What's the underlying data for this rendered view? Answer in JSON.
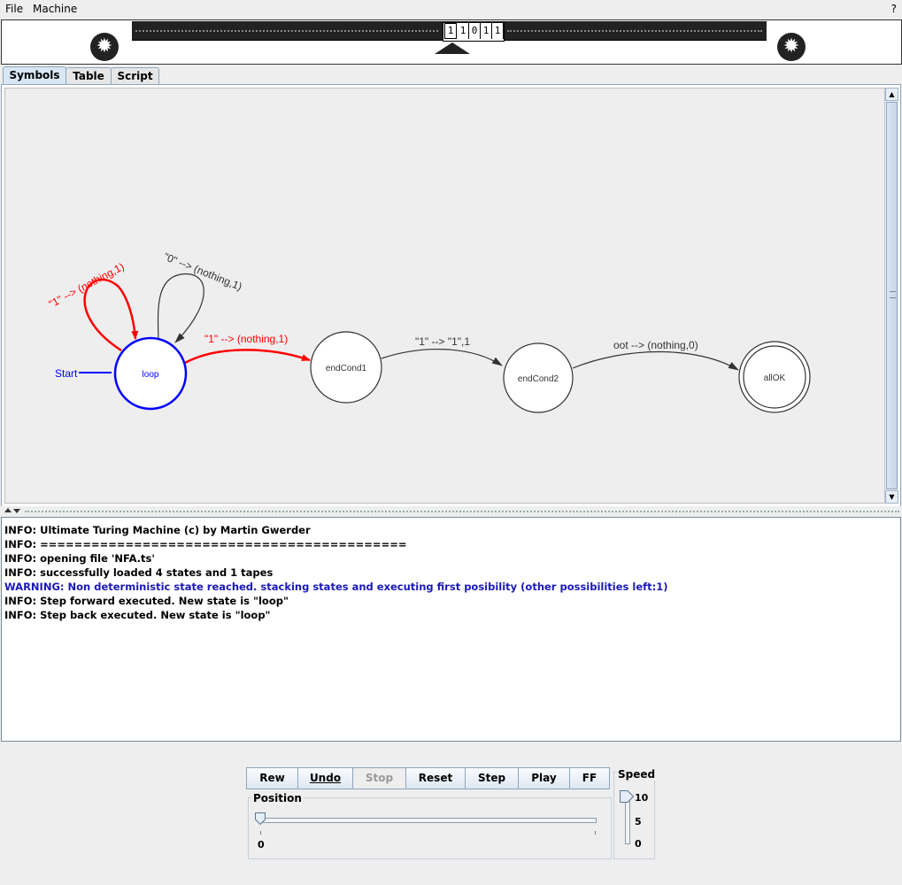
{
  "menu": {
    "file": "File",
    "machine": "Machine",
    "help": "?"
  },
  "tape": {
    "cells": [
      "1",
      "1",
      "0",
      "1",
      "1"
    ],
    "head_index": 0
  },
  "tabs": [
    {
      "label": "Symbols",
      "active": true
    },
    {
      "label": "Table",
      "active": false
    },
    {
      "label": "Script",
      "active": false
    }
  ],
  "diagram": {
    "start_label": "Start",
    "states": [
      {
        "id": "loop",
        "name": "loop",
        "current": true,
        "accepting": false
      },
      {
        "id": "endCond1",
        "name": "endCond1",
        "current": false,
        "accepting": false
      },
      {
        "id": "endCond2",
        "name": "endCond2",
        "current": false,
        "accepting": false
      },
      {
        "id": "allOK",
        "name": "allOK",
        "current": false,
        "accepting": true
      }
    ],
    "transitions": [
      {
        "from": "loop",
        "to": "loop",
        "label": "\"1\" --> (nothing,1)",
        "active": true
      },
      {
        "from": "loop",
        "to": "loop",
        "label": "\"0\" --> (nothing,1)",
        "active": false
      },
      {
        "from": "loop",
        "to": "endCond1",
        "label": "\"1\" --> (nothing,1)",
        "active": true
      },
      {
        "from": "endCond1",
        "to": "endCond2",
        "label": "\"1\" --> \"1\",1",
        "active": false
      },
      {
        "from": "endCond2",
        "to": "allOK",
        "label": "oot --> (nothing,0)",
        "active": false
      }
    ],
    "colors": {
      "active": "#ff0000",
      "current": "#0000ff",
      "normal": "#333333"
    }
  },
  "log": [
    {
      "level": "info",
      "text": "INFO: Ultimate Turing Machine (c) by Martin Gwerder"
    },
    {
      "level": "info",
      "text": "INFO: ==========================================="
    },
    {
      "level": "info",
      "text": "INFO: opening file 'NFA.ts'"
    },
    {
      "level": "info",
      "text": "INFO: successfully loaded 4 states and 1 tapes"
    },
    {
      "level": "warning",
      "text": "WARNING: Non deterministic state reached. stacking states and executing first posibility (other possibilities left:1)"
    },
    {
      "level": "info",
      "text": "INFO: Step forward executed. New state is \"loop\""
    },
    {
      "level": "info",
      "text": "INFO: Step back executed. New state is \"loop\""
    }
  ],
  "controls": {
    "buttons": [
      {
        "label": "Rew",
        "enabled": true
      },
      {
        "label": "Undo",
        "enabled": true
      },
      {
        "label": "Stop",
        "enabled": false
      },
      {
        "label": "Reset",
        "enabled": true
      },
      {
        "label": "Step",
        "enabled": true
      },
      {
        "label": "Play",
        "enabled": true
      },
      {
        "label": "FF",
        "enabled": true
      }
    ],
    "position": {
      "title": "Position",
      "value": 0,
      "min_label": "0"
    },
    "speed": {
      "title": "Speed",
      "value": 10,
      "labels": [
        "10",
        "5",
        "0"
      ]
    }
  }
}
